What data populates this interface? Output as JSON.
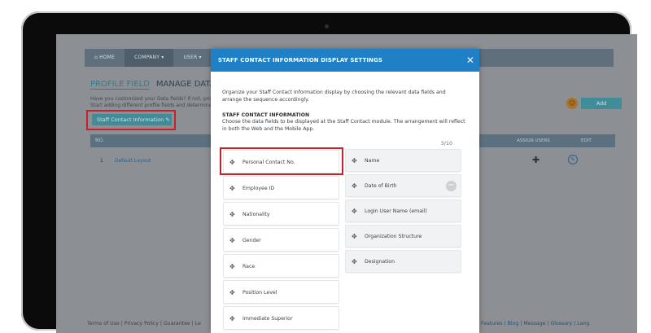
{
  "nav": {
    "items": [
      {
        "label": "⌂ HOME"
      },
      {
        "label": "COMPANY ▾"
      },
      {
        "label": "USER ▾"
      }
    ]
  },
  "profile": {
    "tabs": [
      "PROFILE FIELD",
      "MANAGE DATA FIE"
    ],
    "help_text": "Have you customized your Data fields? If not, proc Start adding different profile fields and determine",
    "staff_button": "Staff Contact Information ✎",
    "add_button": "Add",
    "table": {
      "headers": {
        "no": "NO.",
        "assign": "ASSIGN USERS",
        "edit": "EDIT"
      },
      "rows": [
        {
          "no": "1",
          "name": "Default Layout"
        }
      ]
    }
  },
  "footer": {
    "left": "Terms of Use  |  Privacy Policy  |  Guarantee  |  Le",
    "right": "Features  |  Blog  |  Message  |  Glossary  |  Lang"
  },
  "modal": {
    "title": "STAFF CONTACT INFORMATION DISPLAY SETTINGS",
    "intro": "Organize your Staff Contact Information display by choosing the relevant data fields and arrange the sequence accordingly.",
    "section_title": "STAFF CONTACT INFORMATION",
    "section_desc": "Choose the data fields to be displayed at the Staff Contact module. The arrangement will reflect in both the Web and the Mobile App.",
    "counter": "5/10",
    "available_fields": [
      "Personal Contact No.",
      "Employee ID",
      "Nationality",
      "Gender",
      "Race",
      "Position Level",
      "Immediate Superior"
    ],
    "selected_fields": [
      "Name",
      "Date of Birth",
      "Login User Name (email)",
      "Organization Structure",
      "Designation"
    ]
  },
  "icons": {
    "drag": "drag-handle-icon",
    "close": "close-icon",
    "remove": "minus-circle-icon",
    "plus": "plus-icon",
    "edit": "pencil-icon"
  },
  "colors": {
    "modal_header": "#1f80c6",
    "highlight": "#c8202a",
    "teal_button": "#3f8d99"
  }
}
